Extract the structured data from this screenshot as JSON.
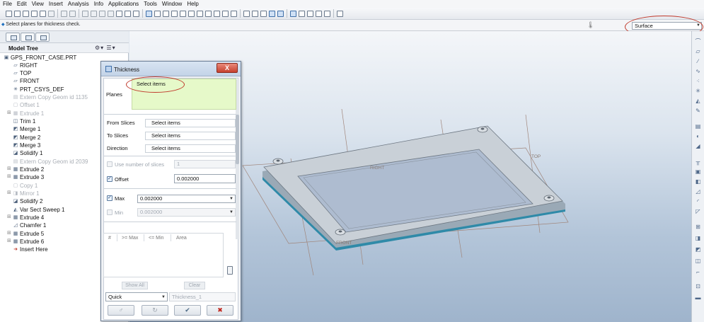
{
  "menu": [
    "File",
    "Edit",
    "View",
    "Insert",
    "Analysis",
    "Info",
    "Applications",
    "Tools",
    "Window",
    "Help"
  ],
  "status": {
    "message": "Select planes for thickness check.",
    "filter_value": "Surface"
  },
  "model_tree": {
    "title": "Model Tree",
    "items": [
      {
        "label": "GPS_FRONT_CASE.PRT",
        "state": "normal"
      },
      {
        "label": "RIGHT",
        "state": "normal"
      },
      {
        "label": "TOP",
        "state": "normal"
      },
      {
        "label": "FRONT",
        "state": "normal"
      },
      {
        "label": "PRT_CSYS_DEF",
        "state": "normal"
      },
      {
        "label": "Extern Copy Geom id 1135",
        "state": "dim"
      },
      {
        "label": "Offset 1",
        "state": "dim"
      },
      {
        "label": "Extrude 1",
        "state": "dim"
      },
      {
        "label": "Trim 1",
        "state": "normal"
      },
      {
        "label": "Merge 1",
        "state": "normal"
      },
      {
        "label": "Merge 2",
        "state": "normal"
      },
      {
        "label": "Merge 3",
        "state": "normal"
      },
      {
        "label": "Solidify 1",
        "state": "normal"
      },
      {
        "label": "Extern Copy Geom id 2039",
        "state": "dim"
      },
      {
        "label": "Extrude 2",
        "state": "normal"
      },
      {
        "label": "Extrude 3",
        "state": "normal"
      },
      {
        "label": "Copy 1",
        "state": "dim"
      },
      {
        "label": "Mirror 1",
        "state": "dim"
      },
      {
        "label": "Solidify 2",
        "state": "normal"
      },
      {
        "label": "Var Sect Sweep 1",
        "state": "normal"
      },
      {
        "label": "Extrude 4",
        "state": "normal"
      },
      {
        "label": "Chamfer 1",
        "state": "normal"
      },
      {
        "label": "Extrude 5",
        "state": "normal"
      },
      {
        "label": "Extrude 6",
        "state": "normal"
      },
      {
        "label": "Insert Here",
        "state": "normal"
      }
    ]
  },
  "dialog": {
    "title": "Thickness",
    "close_label": "X",
    "planes_label": "Planes",
    "planes_hint": "Select items",
    "from_slices_label": "From Slices",
    "from_slices_value": "Select items",
    "to_slices_label": "To Slices",
    "to_slices_value": "Select items",
    "direction_label": "Direction",
    "direction_value": "Select items",
    "use_slices_label": "Use number of slices",
    "use_slices_checked": false,
    "slices_value": "1",
    "offset_label": "Offset",
    "offset_checked": true,
    "offset_value": "0.002000",
    "max_label": "Max",
    "max_checked": true,
    "max_value": "0.002000",
    "min_label": "Min",
    "min_checked": false,
    "min_value": "0.002000",
    "list_columns": [
      "#",
      ">= Max",
      "<= Min",
      "Area"
    ],
    "show_all_label": "Show All",
    "clear_label": "Clear",
    "mode_value": "Quick",
    "feature_name": "Thickness_1",
    "preview_symbol": "♂",
    "repaint_symbol": "↻",
    "ok_symbol": "✔",
    "cancel_symbol": "✖"
  },
  "viewport": {
    "plane_labels": [
      "RIGHT",
      "TOP",
      "FRONT"
    ]
  },
  "colors": {
    "highlight_oval": "#c0392b",
    "planes_bg": "#e6f9c9",
    "model_teal": "#2f8aa8"
  }
}
